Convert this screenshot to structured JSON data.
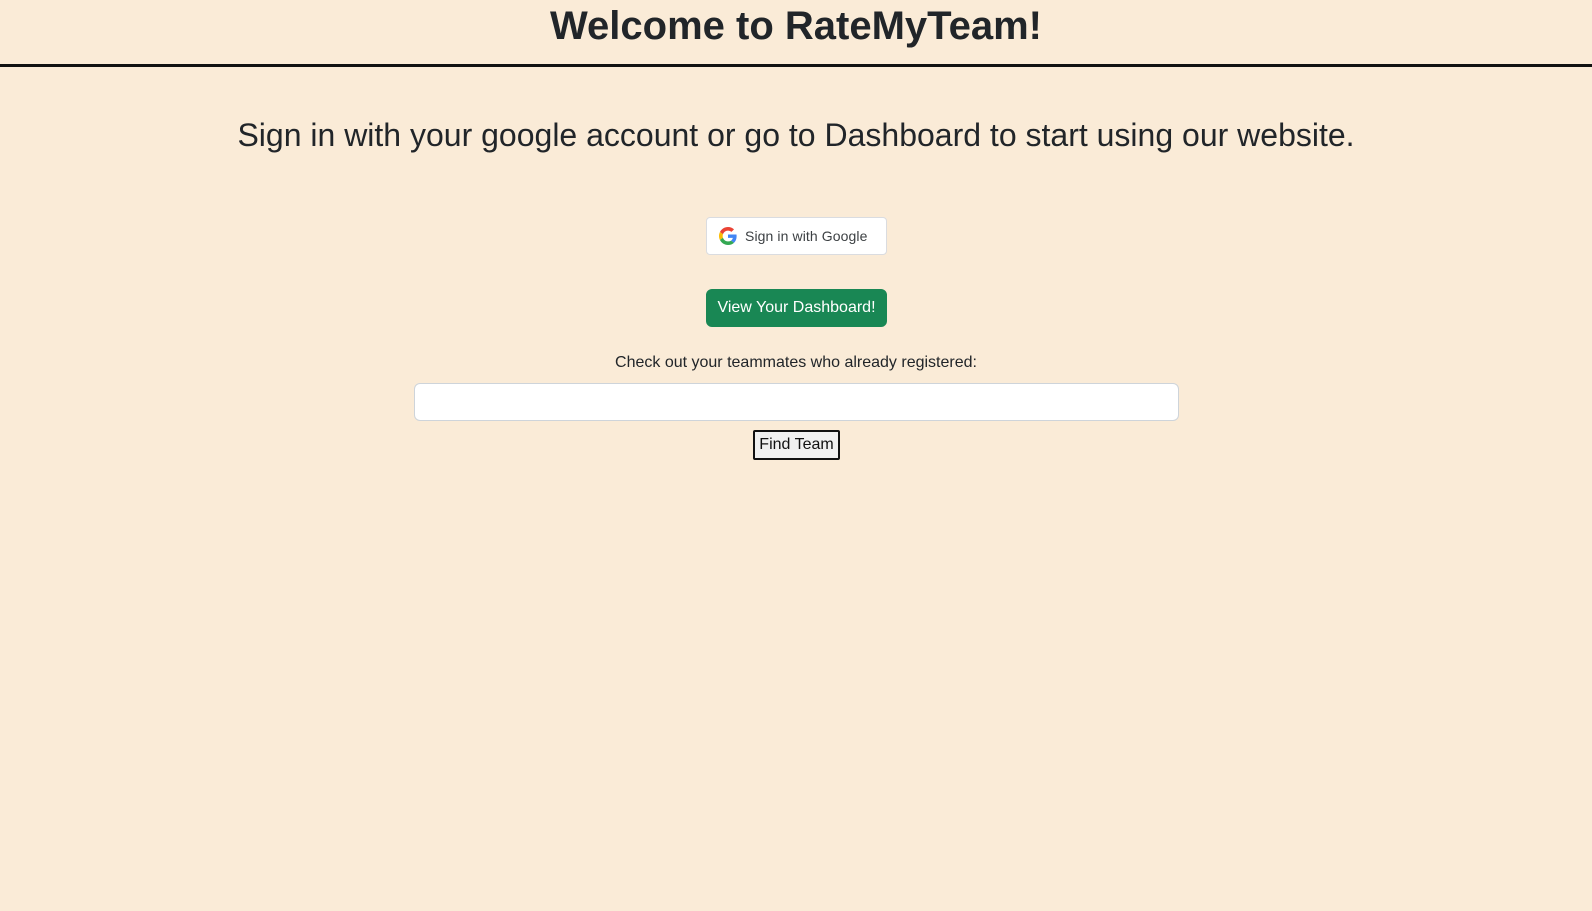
{
  "header": {
    "title": "Welcome to RateMyTeam!"
  },
  "main": {
    "subtitle": "Sign in with your google account or go to Dashboard to start using our website.",
    "google_button": {
      "label": "Sign in with Google",
      "icon": "google-g-icon"
    },
    "dashboard_button": {
      "label": "View Your Dashboard!",
      "color": "#198754"
    },
    "team_search": {
      "prompt": "Check out your teammates who already registered:",
      "value": "",
      "placeholder": "",
      "button_label": "Find Team"
    }
  },
  "colors": {
    "background": "#faebd7",
    "accent": "#198754"
  }
}
